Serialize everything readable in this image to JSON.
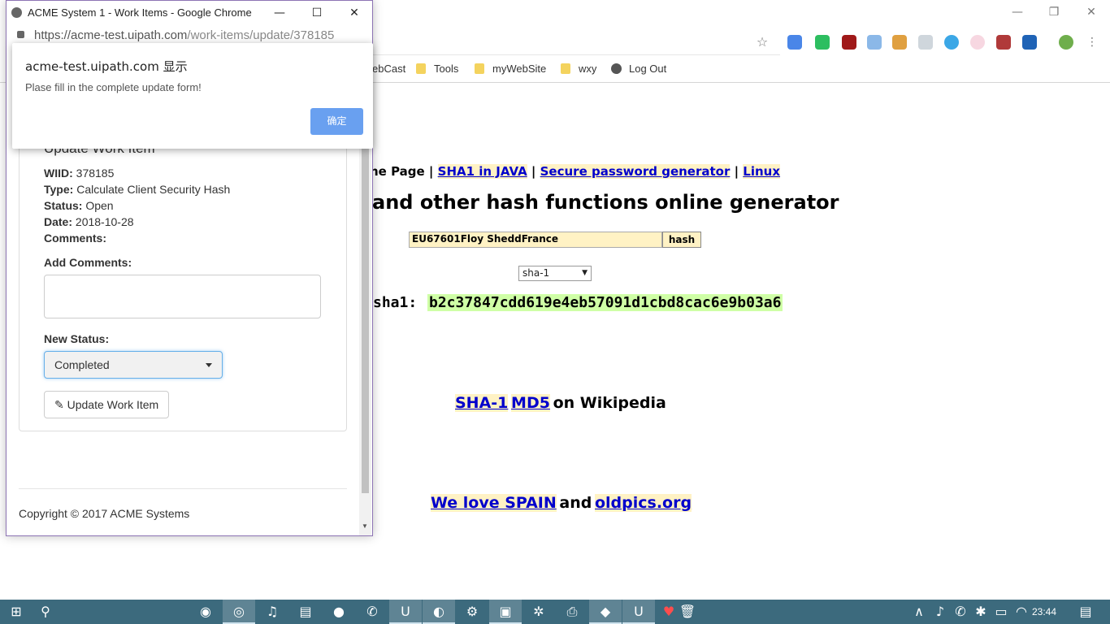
{
  "bg_browser": {
    "bookmarks": [
      "ebCast",
      "Tools",
      "myWebSite",
      "wxy",
      "Log Out"
    ]
  },
  "hash_page": {
    "nav_text_prefix": "ne Page |",
    "nav_links": [
      "SHA1 in JAVA",
      "Secure password generator",
      "Linux"
    ],
    "title": "and other hash functions online generator",
    "input_value": "EU67601Floy SheddFrance",
    "hash_button": "hash",
    "algorithm": "sha-1",
    "result_label": "sha1:",
    "result_value": "b2c37847cdd619e4eb57091d1cbd8cac6e9b03a6",
    "wiki_links": [
      "SHA-1",
      "MD5"
    ],
    "wiki_suffix": "on Wikipedia",
    "spain_link": "We love SPAIN",
    "and_word": "and",
    "oldpics_link": "oldpics.org"
  },
  "popup": {
    "window_title": "ACME System 1 - Work Items - Google Chrome",
    "url_host": "https://acme-test.uipath.com",
    "url_path": "/work-items/update/378185",
    "form": {
      "heading": "Update Work Item",
      "wiid_label": "WIID:",
      "wiid_value": "378185",
      "type_label": "Type:",
      "type_value": "Calculate Client Security Hash",
      "status_label": "Status:",
      "status_value": "Open",
      "date_label": "Date:",
      "date_value": "2018-10-28",
      "comments_label": "Comments:",
      "add_comments_label": "Add Comments:",
      "new_status_label": "New Status:",
      "new_status_value": "Completed",
      "update_button": "Update Work Item"
    },
    "footer": "Copyright © 2017 ACME Systems"
  },
  "alert": {
    "title": "acme-test.uipath.com 显示",
    "message": "Plase fill in the complete update form!",
    "ok_label": "确定"
  },
  "taskbar": {
    "time": "23:44"
  }
}
